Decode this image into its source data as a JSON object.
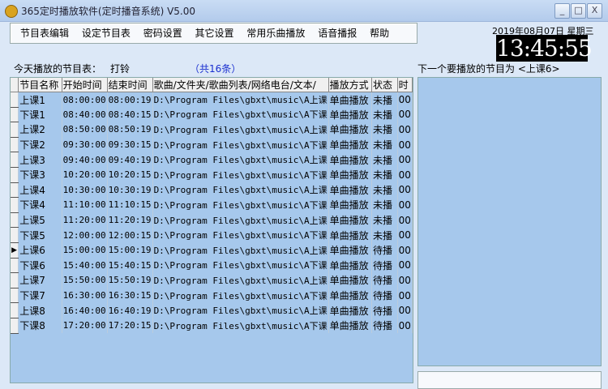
{
  "window": {
    "title": "365定时播放软件(定时播音系统) V5.00",
    "min": "_",
    "max": "□",
    "close": "X"
  },
  "menu": [
    "节目表编辑",
    "设定节目表",
    "密码设置",
    "其它设置",
    "常用乐曲播放",
    "语音播报",
    "帮助"
  ],
  "date": "2019年08月07日  星期三",
  "clock": "13:45:55",
  "today_label": "今天播放的节目表：",
  "today_name": "打铃",
  "count": "（共16条）",
  "next_label": "下一个要播放的节目为 <上课6>",
  "columns": [
    "节目名称",
    "开始时间",
    "结束时间",
    "歌曲/文件夹/歌曲列表/网络电台/文本/",
    "播放方式",
    "状态",
    "时"
  ],
  "current_row": 10,
  "rows": [
    [
      "上课1",
      "08:00:00",
      "08:00:19",
      "D:\\Program Files\\gbxt\\music\\A上课",
      "单曲播放",
      "未播",
      "00"
    ],
    [
      "下课1",
      "08:40:00",
      "08:40:15",
      "D:\\Program Files\\gbxt\\music\\A下课",
      "单曲播放",
      "未播",
      "00"
    ],
    [
      "上课2",
      "08:50:00",
      "08:50:19",
      "D:\\Program Files\\gbxt\\music\\A上课",
      "单曲播放",
      "未播",
      "00"
    ],
    [
      "下课2",
      "09:30:00",
      "09:30:15",
      "D:\\Program Files\\gbxt\\music\\A下课",
      "单曲播放",
      "未播",
      "00"
    ],
    [
      "上课3",
      "09:40:00",
      "09:40:19",
      "D:\\Program Files\\gbxt\\music\\A上课",
      "单曲播放",
      "未播",
      "00"
    ],
    [
      "下课3",
      "10:20:00",
      "10:20:15",
      "D:\\Program Files\\gbxt\\music\\A下课",
      "单曲播放",
      "未播",
      "00"
    ],
    [
      "上课4",
      "10:30:00",
      "10:30:19",
      "D:\\Program Files\\gbxt\\music\\A上课",
      "单曲播放",
      "未播",
      "00"
    ],
    [
      "下课4",
      "11:10:00",
      "11:10:15",
      "D:\\Program Files\\gbxt\\music\\A下课",
      "单曲播放",
      "未播",
      "00"
    ],
    [
      "上课5",
      "11:20:00",
      "11:20:19",
      "D:\\Program Files\\gbxt\\music\\A上课",
      "单曲播放",
      "未播",
      "00"
    ],
    [
      "下课5",
      "12:00:00",
      "12:00:15",
      "D:\\Program Files\\gbxt\\music\\A下课",
      "单曲播放",
      "未播",
      "00"
    ],
    [
      "上课6",
      "15:00:00",
      "15:00:19",
      "D:\\Program Files\\gbxt\\music\\A上课",
      "单曲播放",
      "待播",
      "00"
    ],
    [
      "下课6",
      "15:40:00",
      "15:40:15",
      "D:\\Program Files\\gbxt\\music\\A下课",
      "单曲播放",
      "待播",
      "00"
    ],
    [
      "上课7",
      "15:50:00",
      "15:50:19",
      "D:\\Program Files\\gbxt\\music\\A上课",
      "单曲播放",
      "待播",
      "00"
    ],
    [
      "下课7",
      "16:30:00",
      "16:30:15",
      "D:\\Program Files\\gbxt\\music\\A下课",
      "单曲播放",
      "待播",
      "00"
    ],
    [
      "上课8",
      "16:40:00",
      "16:40:19",
      "D:\\Program Files\\gbxt\\music\\A上课",
      "单曲播放",
      "待播",
      "00"
    ],
    [
      "下课8",
      "17:20:00",
      "17:20:15",
      "D:\\Program Files\\gbxt\\music\\A下课",
      "单曲播放",
      "待播",
      "00"
    ]
  ]
}
